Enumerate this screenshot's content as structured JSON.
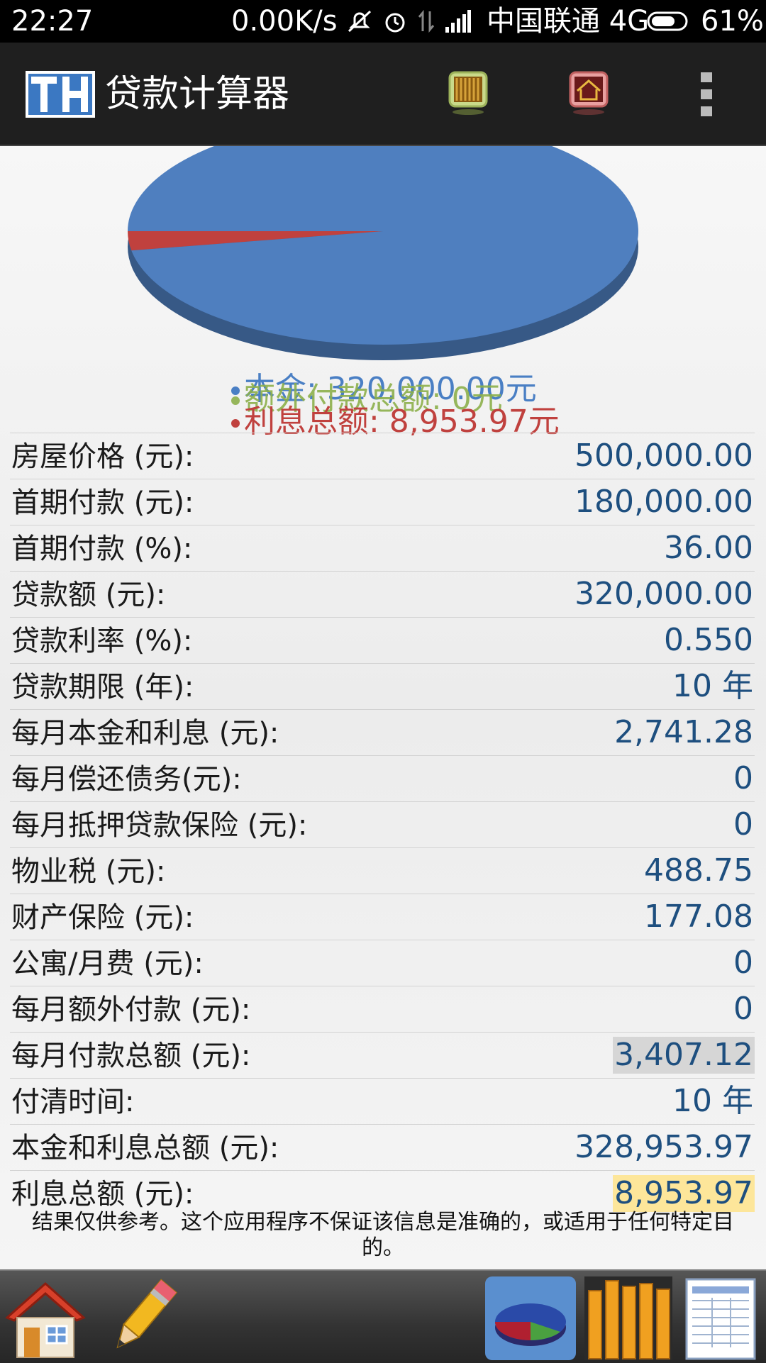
{
  "status_bar": {
    "time": "22:27",
    "net_speed": "0.00K/s",
    "carrier": "中国联通 4G",
    "battery": "61%",
    "icons": [
      "mute-icon",
      "alarm-icon",
      "data-arrows-icon",
      "signal-icon",
      "battery-icon"
    ]
  },
  "app_bar": {
    "logo_text": "TH",
    "title": "贷款计算器",
    "actions": [
      "bar-chart-icon",
      "house-icon",
      "overflow-menu-icon"
    ]
  },
  "chart_data": {
    "type": "pie",
    "slices": [
      {
        "name": "本金",
        "value": 320000.0
      },
      {
        "name": "额外付款总额",
        "value": 0
      },
      {
        "name": "利息总额",
        "value": 8953.97
      }
    ],
    "legend": [
      "本金: 320,000.00元",
      "额外付款总额: 0元",
      "利息总额: 8,953.97元"
    ],
    "colors": [
      "#4f7fbf",
      "#8db04b",
      "#c0413e"
    ]
  },
  "rows": [
    {
      "label": "房屋价格 (元):",
      "value": "500,000.00"
    },
    {
      "label": "首期付款 (元):",
      "value": "180,000.00"
    },
    {
      "label": "首期付款 (%):",
      "value": "36.00"
    },
    {
      "label": "贷款额 (元):",
      "value": "320,000.00"
    },
    {
      "label": "贷款利率 (%):",
      "value": "0.550"
    },
    {
      "label": "贷款期限 (年):",
      "value": "10 年"
    },
    {
      "label": "每月本金和利息 (元):",
      "value": "2,741.28"
    },
    {
      "label": "每月偿还债务(元):",
      "value": "0"
    },
    {
      "label": "每月抵押贷款保险 (元):",
      "value": "0"
    },
    {
      "label": "物业税 (元):",
      "value": "488.75"
    },
    {
      "label": "财产保险 (元):",
      "value": "177.08"
    },
    {
      "label": "公寓/月费 (元):",
      "value": "0"
    },
    {
      "label": "每月额外付款 (元):",
      "value": "0"
    },
    {
      "label": "每月付款总额 (元):",
      "value": "3,407.12"
    },
    {
      "label": "付清时间:",
      "value": "10 年"
    },
    {
      "label": "本金和利息总额 (元):",
      "value": "328,953.97"
    },
    {
      "label": "利息总额 (元):",
      "value": "8,953.97"
    }
  ],
  "highlight_colors": {
    "monthly_total": "#d6d6d6",
    "interest_total": "#fde69a"
  },
  "disclaimer": "结果仅供参考。这个应用程序不保证该信息是准确的，或适用于任何特定目的。",
  "bottom_toolbar": [
    "home-icon",
    "edit-pencil-icon",
    "pie-chart-icon",
    "bar-chart-icon",
    "spreadsheet-icon"
  ],
  "selected_tab": "pie-chart-icon"
}
